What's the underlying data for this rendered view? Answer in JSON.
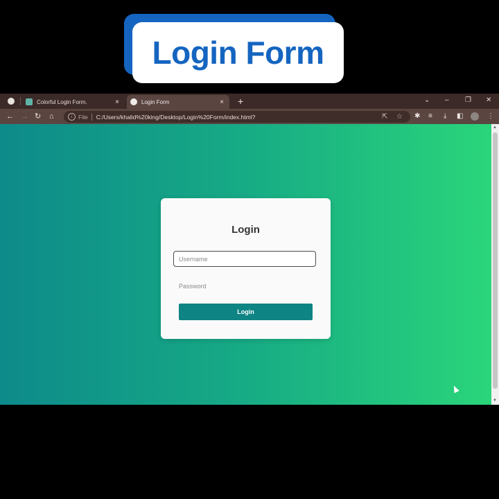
{
  "banner": {
    "title": "Login Form"
  },
  "browser": {
    "tabs": [
      {
        "title": "Colorful Login Form.",
        "close": "×",
        "active": false
      },
      {
        "title": "Login Form",
        "close": "×",
        "active": true
      }
    ],
    "new_tab": "+",
    "window_controls": {
      "list": "⌄",
      "minimize": "–",
      "restore": "❐",
      "close": "✕"
    },
    "nav": {
      "back": "←",
      "forward": "→",
      "reload": "↻",
      "home": "⌂"
    },
    "omnibox": {
      "info": "i",
      "file_label": "File",
      "url": "C:/Users/khalid%20king/Desktop/Login%20Form/index.html?"
    }
  },
  "form": {
    "title": "Login",
    "username_placeholder": "Username",
    "password_placeholder": "Password",
    "login_label": "Login"
  }
}
